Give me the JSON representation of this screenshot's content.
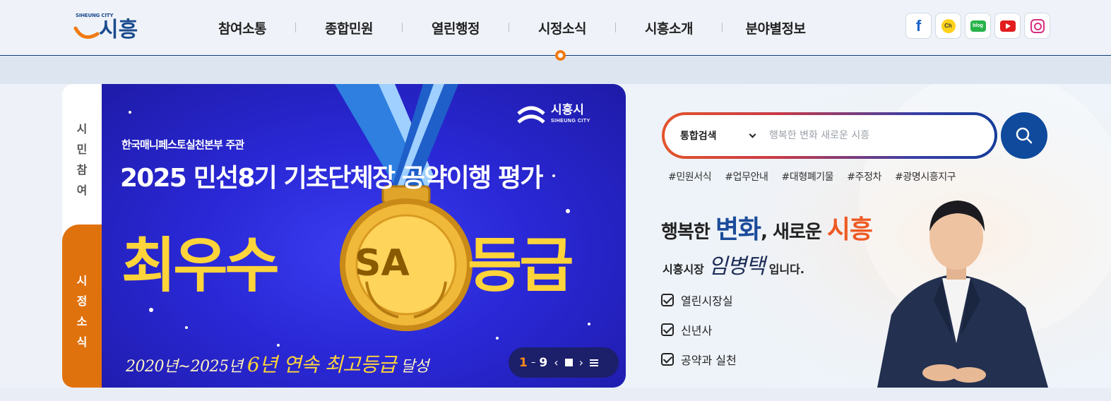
{
  "header": {
    "logo_en": "SIHEUNG CITY",
    "logo_ko": "시흥",
    "nav": [
      "참여소통",
      "종합민원",
      "열린행정",
      "시정소식",
      "시흥소개",
      "분야별정보"
    ],
    "active_nav": "시정소식",
    "sns": [
      "facebook-icon",
      "kakao-channel-icon",
      "blog-icon",
      "youtube-icon",
      "instagram-icon"
    ],
    "sns_text": {
      "facebook": "f",
      "channel": "Ch",
      "blog": "blog"
    }
  },
  "side_tabs": {
    "citizen": [
      "시",
      "민",
      "참",
      "여"
    ],
    "news": [
      "시",
      "정",
      "소",
      "식"
    ]
  },
  "banner": {
    "org": "한국매니페스토실천본부 주관",
    "title": "2025 민선8기 기초단체장 공약이행 평가",
    "grade_left": "최우수",
    "grade_badge": "SA",
    "grade_right": "등급",
    "bottom_pre": "2020년~2025년",
    "bottom_hl": "6년 연속 최고등급",
    "bottom_post": "달성",
    "logo_ko": "시흥시",
    "logo_en": "SIHEUNG CITY",
    "pager": {
      "current": "1",
      "total": "9"
    }
  },
  "search": {
    "select_value": "통합검색",
    "placeholder": "행복한 변화 새로운 시흥",
    "tags": [
      "#민원서식",
      "#업무안내",
      "#대형폐기물",
      "#주정차",
      "#광명시흥지구"
    ]
  },
  "mayor": {
    "slogan_1": "행복한 ",
    "slogan_2": "변화",
    "slogan_3": ", 새로운 ",
    "slogan_4": "시흥",
    "title": "시흥시장",
    "name": "임병택",
    "suffix": "입니다.",
    "links": [
      "열린시장실",
      "신년사",
      "공약과 실천"
    ]
  },
  "colors": {
    "brand_blue": "#0f4a9c",
    "accent_orange": "#e0720e",
    "banner_blue": "#2a28d6",
    "gold": "#ffd43a"
  }
}
